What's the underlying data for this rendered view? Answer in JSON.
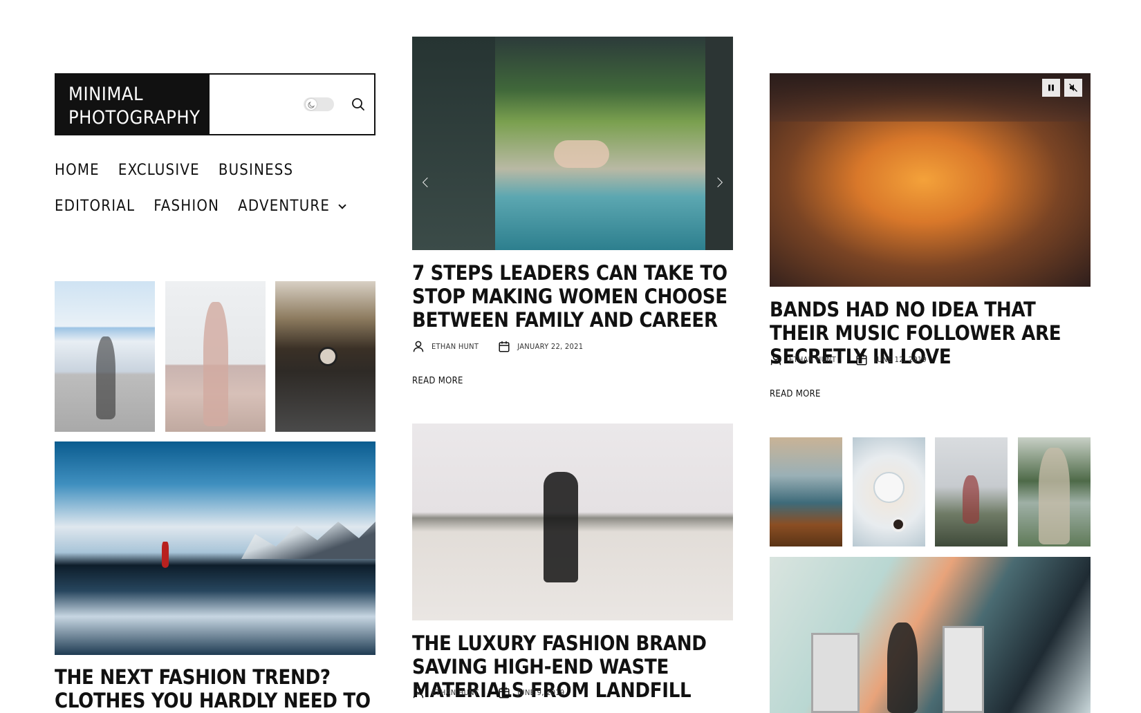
{
  "brand": {
    "title_line1": "MINIMAL",
    "title_line2": "PHOTOGRAPHY"
  },
  "header": {
    "dark_mode_toggle": "off",
    "search_icon": "search-icon",
    "moon_icon": "moon-icon"
  },
  "nav": {
    "items": [
      "HOME",
      "EXCLUSIVE",
      "BUSINESS",
      "EDITORIAL",
      "FASHION",
      "ADVENTURE"
    ],
    "dropdown_icon": "chevron-down-icon"
  },
  "posts": {
    "slider": {
      "title": "7 STEPS LEADERS CAN TAKE TO STOP MAKING WOMEN CHOOSE BETWEEN FAMILY AND CAREER",
      "author": "ETHAN HUNT",
      "date": "JANUARY 22, 2021",
      "read_more": "READ MORE"
    },
    "video": {
      "title": "BANDS HAD NO IDEA THAT THEIR MUSIC FOLLOWER ARE SECRETLY IN LOVE",
      "author": "ETHAN HUNT",
      "date": "JUNE 12, 2019",
      "read_more": "READ MORE"
    },
    "beach": {
      "title": "THE LUXURY FASHION BRAND SAVING HIGH-END WASTE MATERIALS FROM LANDFILL",
      "author": "ETHAN HUNT",
      "date": "JUNE 9, 2019"
    },
    "lake": {
      "title": "THE NEXT FASHION TREND? CLOTHES YOU HARDLY NEED TO WASH"
    }
  },
  "icons": {
    "author": "user-icon",
    "date": "calendar-icon",
    "pause": "pause-icon",
    "mute": "mute-icon",
    "prev": "chevron-left-icon",
    "next": "chevron-right-icon"
  },
  "colors": {
    "text": "#111111",
    "background": "#ffffff",
    "brand_bg": "#111111",
    "brand_text": "#ffffff"
  }
}
